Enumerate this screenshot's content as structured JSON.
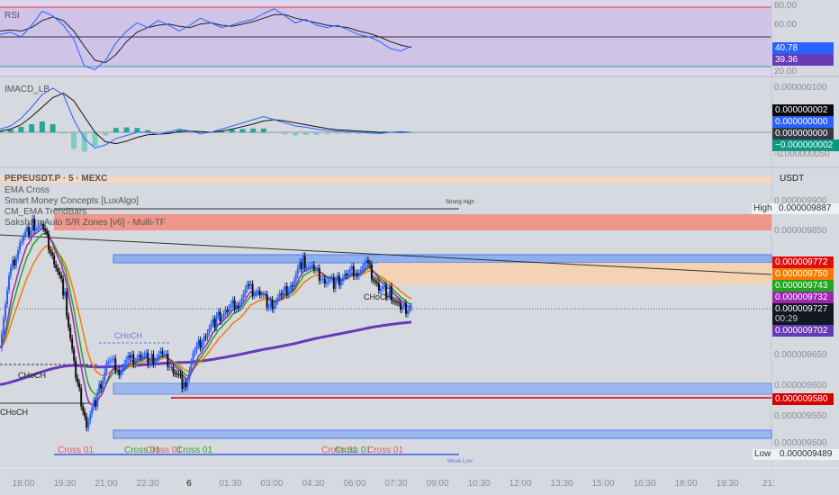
{
  "rsi": {
    "title": "RSI",
    "axis": [
      "80.00",
      "60.00",
      "20.00"
    ],
    "tags": [
      {
        "v": "40.78",
        "c": "#2962ff"
      },
      {
        "v": "39.36",
        "c": "#673ab7"
      }
    ],
    "line": [
      52,
      54,
      50,
      60,
      72,
      68,
      60,
      48,
      25,
      22,
      30,
      45,
      55,
      62,
      58,
      64,
      60,
      55,
      60,
      66,
      62,
      58,
      60,
      63,
      65,
      70,
      74,
      68,
      62,
      65,
      60,
      58,
      60,
      56,
      52,
      50,
      46,
      40,
      38,
      42
    ],
    "signal": [
      55,
      56,
      55,
      58,
      64,
      67,
      64,
      55,
      42,
      30,
      28,
      35,
      46,
      54,
      58,
      60,
      61,
      59,
      58,
      61,
      62,
      60,
      59,
      61,
      63,
      66,
      69,
      69,
      66,
      64,
      62,
      60,
      59,
      58,
      55,
      53,
      50,
      46,
      43,
      41
    ]
  },
  "macd": {
    "title": "IMACD_LB",
    "axis": [
      "0.000000100",
      "-0.000000050"
    ],
    "tags": [
      {
        "v": "0.000000002",
        "c": "#0b0b0f"
      },
      {
        "v": "0.000000000",
        "c": "#2962ff"
      },
      {
        "v": "0.000000000",
        "c": "#363a45"
      },
      {
        "v": "−0.000000002",
        "c": "#089981"
      }
    ],
    "line": [
      5,
      10,
      22,
      40,
      60,
      70,
      60,
      20,
      -10,
      -25,
      -20,
      -10,
      -5,
      0,
      0,
      -3,
      0,
      5,
      2,
      -2,
      0,
      5,
      10,
      15,
      20,
      25,
      20,
      15,
      10,
      8,
      5,
      3,
      2,
      1,
      0,
      -1,
      -2,
      0,
      1,
      0
    ],
    "signal": [
      2,
      5,
      12,
      25,
      40,
      55,
      62,
      50,
      25,
      0,
      -15,
      -18,
      -14,
      -8,
      -4,
      -3,
      -2,
      1,
      2,
      1,
      0,
      2,
      5,
      9,
      13,
      18,
      20,
      18,
      15,
      12,
      9,
      6,
      4,
      3,
      2,
      1,
      0,
      0,
      0,
      0
    ]
  },
  "main": {
    "symbol": "PEPEUSDT.P · 5 · MEXC",
    "indicators": [
      "EMA Cross",
      "Smart Money Concepts [LuxAlgo]",
      "CM_EMA TrendBars",
      "Saksham Auto S/R Zones [v6] - Multi-TF"
    ],
    "currency": "USDT",
    "axis": [
      "0.000009900",
      "0.000009850",
      "0.000009650",
      "0.000009600",
      "0.000009550",
      "0.000009500"
    ],
    "high": {
      "label": "High",
      "value": "0.000009887"
    },
    "low": {
      "label": "Low",
      "value": "0.000009489"
    },
    "tags": [
      {
        "v": "0.000009772",
        "c": "#e00d0d"
      },
      {
        "v": "0.000009750",
        "c": "#f57c00"
      },
      {
        "v": "0.000009743",
        "c": "#22a61e"
      },
      {
        "v": "0.000009732",
        "c": "#9c27b0"
      },
      {
        "v": "0.000009727",
        "c": "#131722",
        "sub": "00:29"
      },
      {
        "v": "0.000009702",
        "c": "#673ab7"
      }
    ],
    "sr_tag": {
      "v": "0.000009580",
      "c": "#d50000"
    },
    "labels": {
      "strong_high": "Strong High",
      "weak_low": "Weak Low",
      "choch": "CHoCH",
      "cross": "Cross 01"
    },
    "prices": [
      9670,
      9788,
      9839,
      9862,
      9854,
      9803,
      9744,
      9611,
      9537,
      9581,
      9640,
      9625,
      9640,
      9648,
      9640,
      9648,
      9625,
      9596,
      9655,
      9685,
      9707,
      9721,
      9736,
      9758,
      9751,
      9729,
      9744,
      9766,
      9803,
      9788,
      9773,
      9766,
      9780,
      9788,
      9795,
      9758,
      9751,
      9721,
      9727
    ]
  },
  "time_axis": [
    "18:00",
    "19:30",
    "21:00",
    "22:30",
    "6",
    "01:30",
    "03:00",
    "04:30",
    "06:00",
    "07:30",
    "09:00",
    "10:30",
    "12:00",
    "13:30",
    "15:00",
    "16:30",
    "18:00",
    "19:30",
    "21:"
  ]
}
